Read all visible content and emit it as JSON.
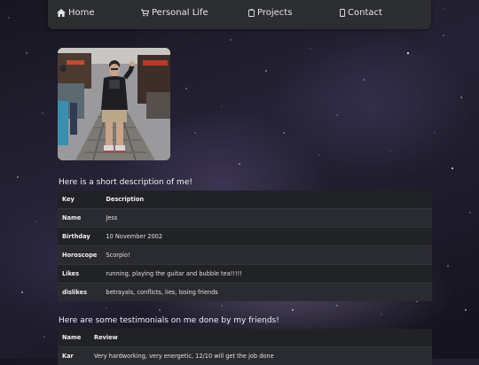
{
  "nav": {
    "items": [
      {
        "label": "Home",
        "icon": "home-icon"
      },
      {
        "label": "Personal Life",
        "icon": "cart-icon"
      },
      {
        "label": "Projects",
        "icon": "clipboard-icon"
      },
      {
        "label": "Contact",
        "icon": "phone-icon"
      }
    ]
  },
  "profile": {
    "description_heading": "Here is a short description of me!",
    "table_headers": {
      "key": "Key",
      "value": "Description"
    },
    "rows": [
      {
        "key": "Name",
        "value": "Jess"
      },
      {
        "key": "Birthday",
        "value": "10 November 2002"
      },
      {
        "key": "Horoscope",
        "value": "Scorpio!"
      },
      {
        "key": "Likes",
        "value": "running, playing the guitar and bubble tea!!!!!"
      },
      {
        "key": "dislikes",
        "value": "betrayals, conflicts, lies, losing friends"
      }
    ]
  },
  "testimonials": {
    "heading": "Here are some testimonials on me done by my friends!",
    "table_headers": {
      "name": "Name",
      "review": "Review"
    },
    "rows": [
      {
        "name": "Kar",
        "review": "Very hardworking, very energetic, 12/10 will get the job done"
      }
    ]
  },
  "colors": {
    "navbar": "#2c2d31",
    "table": "#212226",
    "background": "#1d1a2a"
  }
}
